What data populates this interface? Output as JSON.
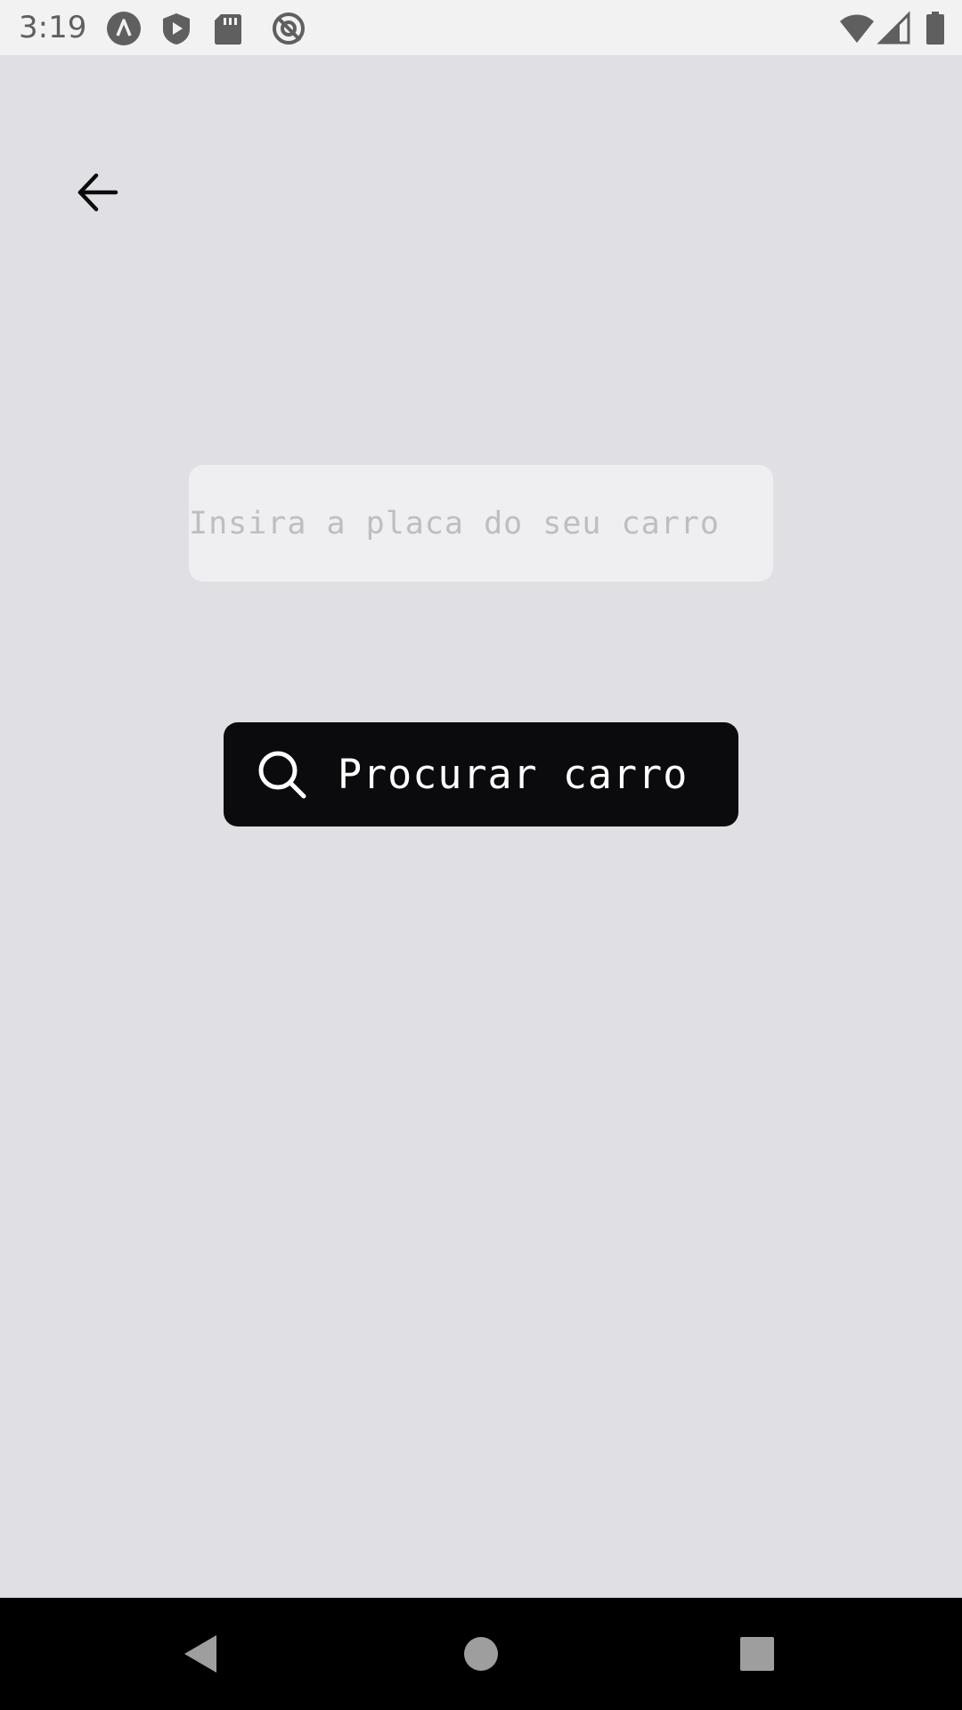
{
  "status_bar": {
    "time": "3:19",
    "icons": [
      "app-a-icon",
      "shield-play-icon",
      "sd-card-icon",
      "at-sign-icon",
      "wifi-icon",
      "signal-icon",
      "battery-icon"
    ]
  },
  "header": {
    "back_icon": "arrow-left-icon"
  },
  "form": {
    "plate_input": {
      "value": "",
      "placeholder": "Insira a placa do seu carro"
    },
    "search_button": {
      "label": "Procurar carro",
      "icon": "search-icon"
    }
  },
  "nav_bar": {
    "buttons": [
      "back-triangle-icon",
      "home-circle-icon",
      "recents-square-icon"
    ]
  },
  "colors": {
    "background": "#e0dfe4",
    "input_background": "#efeff2",
    "button_background": "#0b0b0d",
    "button_text": "#ffffff",
    "placeholder": "#bdbdc2"
  }
}
